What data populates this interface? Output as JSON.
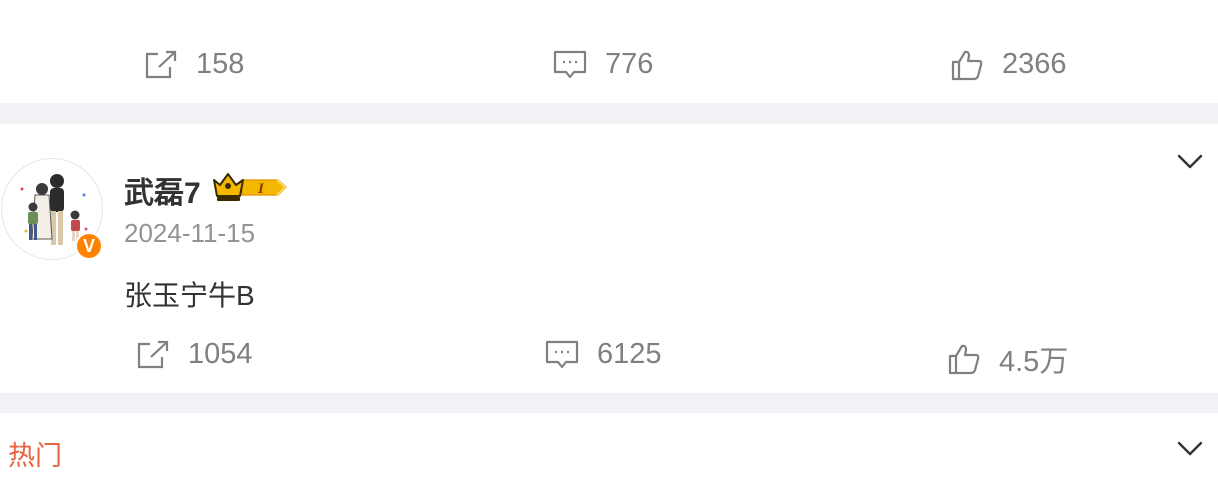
{
  "prev_post": {
    "repost_count": "158",
    "comment_count": "776",
    "like_count": "2366"
  },
  "post": {
    "username": "武磊7",
    "level_badge": "I",
    "verified_badge": "V",
    "date": "2024-11-15",
    "text": "张玉宁牛B",
    "repost_count": "1054",
    "comment_count": "6125",
    "like_count": "4.5万"
  },
  "section": {
    "hot_label": "热门"
  },
  "colors": {
    "separator": "#f1f2f5",
    "muted_text": "#808080",
    "accent_orange": "#ff8200",
    "hot_label": "#e8633f",
    "crown_gold": "#f5b800"
  },
  "icons": [
    "repost-icon",
    "comment-icon",
    "like-icon",
    "chevron-down-icon",
    "crown-icon",
    "verified-icon"
  ]
}
